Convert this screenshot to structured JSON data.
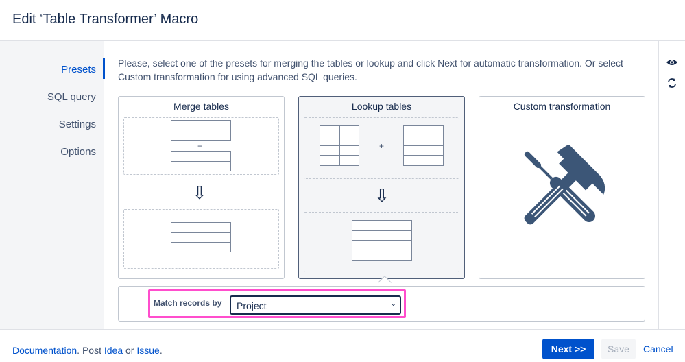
{
  "dialog": {
    "title": "Edit ‘Table Transformer’ Macro"
  },
  "nav": {
    "items": [
      {
        "label": "Presets",
        "active": true
      },
      {
        "label": "SQL query",
        "active": false
      },
      {
        "label": "Settings",
        "active": false
      },
      {
        "label": "Options",
        "active": false
      }
    ]
  },
  "main": {
    "intro": "Please, select one of the presets for merging the tables or lookup and click Next for automatic transformation. Or select Custom transformation for using advanced SQL queries.",
    "presets": [
      {
        "title": "Merge tables",
        "plus": "+",
        "selected": false
      },
      {
        "title": "Lookup tables",
        "plus": "+",
        "selected": true
      },
      {
        "title": "Custom transformation",
        "selected": false,
        "icon": "hammer-screwdriver-icon"
      }
    ],
    "match": {
      "label": "Match records by",
      "value": "Project"
    }
  },
  "rightbar": {
    "icons": [
      "eye-icon",
      "refresh-icon"
    ]
  },
  "footer": {
    "documentation": "Documentation",
    "sep1": ". Post ",
    "idea": "Idea",
    "or": " or ",
    "issue": "Issue",
    "period": ".",
    "next": "Next >>",
    "save": "Save",
    "cancel": "Cancel"
  },
  "colors": {
    "accent": "#0052cc",
    "highlight": "#ff4ecd",
    "tool": "#3c5677"
  }
}
